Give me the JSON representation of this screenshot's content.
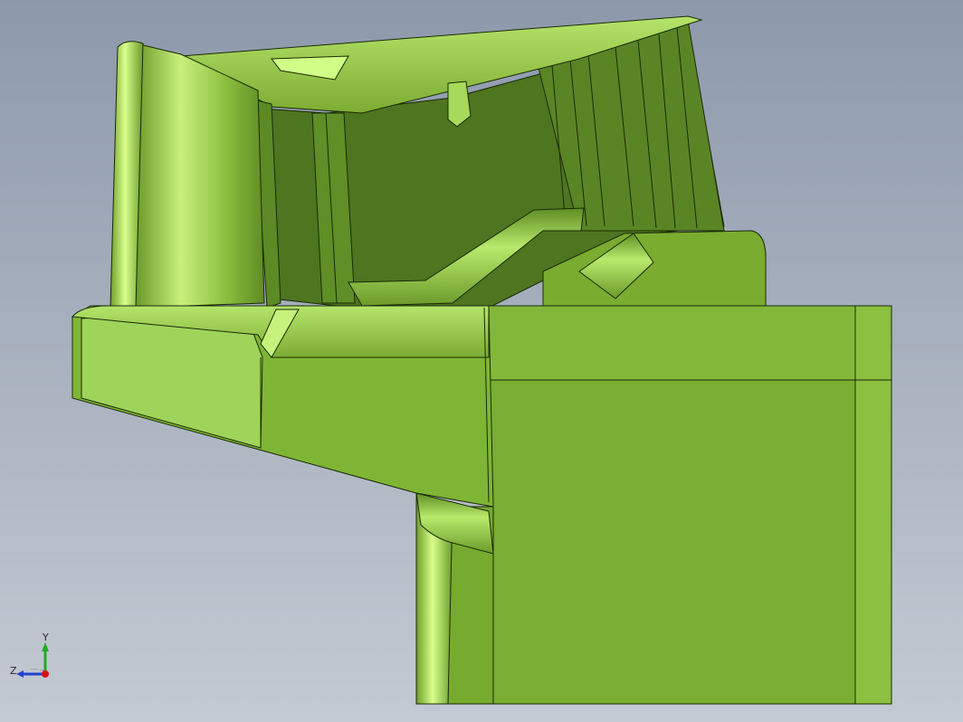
{
  "viewport": {
    "background_top": "#8d99ab",
    "background_bottom": "#c4cad3"
  },
  "model": {
    "color_light": "#a8d85e",
    "color_mid": "#7fb133",
    "color_dark": "#4a6e1e",
    "edge_color": "#1b2a06"
  },
  "triad": {
    "y_label": "Y",
    "z_label": "Z",
    "y_color": "#22aa22",
    "z_color": "#2244cc",
    "x_color": "#dd1111"
  }
}
